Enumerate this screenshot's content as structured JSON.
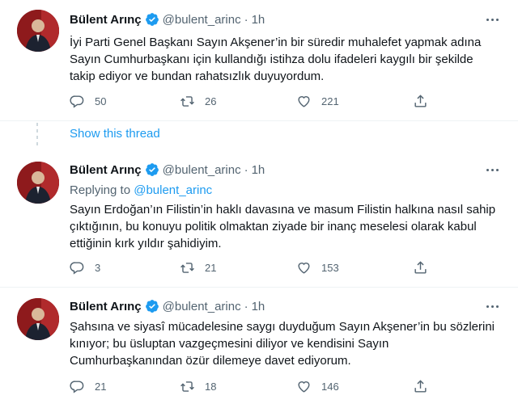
{
  "tweets": [
    {
      "author": "Bülent Arınç",
      "handle": "@bulent_arinc",
      "time": "1h",
      "text": "İyi Parti Genel Başkanı Sayın Akşener’in bir süredir muhalefet yapmak adına Sayın Cumhurbaşkanı için kullandığı istihza dolu ifadeleri kaygılı bir şekilde takip ediyor ve bundan rahatsızlık duyuyordum.",
      "replies": "50",
      "retweets": "26",
      "likes": "221"
    },
    {
      "author": "Bülent Arınç",
      "handle": "@bulent_arinc",
      "time": "1h",
      "replying_prefix": "Replying to",
      "replying_to": "@bulent_arinc",
      "text": "Sayın Erdoğan’ın Filistin’in haklı davasına ve masum Filistin halkına nasıl sahip çıktığının, bu konuyu politik olmaktan ziyade bir inanç meselesi olarak kabul ettiğinin kırk yıldır şahidiyim.",
      "replies": "3",
      "retweets": "21",
      "likes": "153"
    },
    {
      "author": "Bülent Arınç",
      "handle": "@bulent_arinc",
      "time": "1h",
      "text": "Şahsına ve siyasî mücadelesine saygı duyduğum Sayın Akşener’in bu sözlerini kınıyor; bu üsluptan vazgeçmesini diliyor ve kendisini Sayın Cumhurbaşkanından özür dilemeye davet ediyorum.",
      "replies": "21",
      "retweets": "18",
      "likes": "146"
    }
  ],
  "show_thread": "Show this thread",
  "colors": {
    "accent": "#1d9bf0",
    "muted": "#536471",
    "text": "#0f1419",
    "divider": "#eff3f4"
  },
  "icons": [
    "verified-badge-icon",
    "more-icon",
    "reply-icon",
    "retweet-icon",
    "like-icon",
    "share-icon"
  ]
}
